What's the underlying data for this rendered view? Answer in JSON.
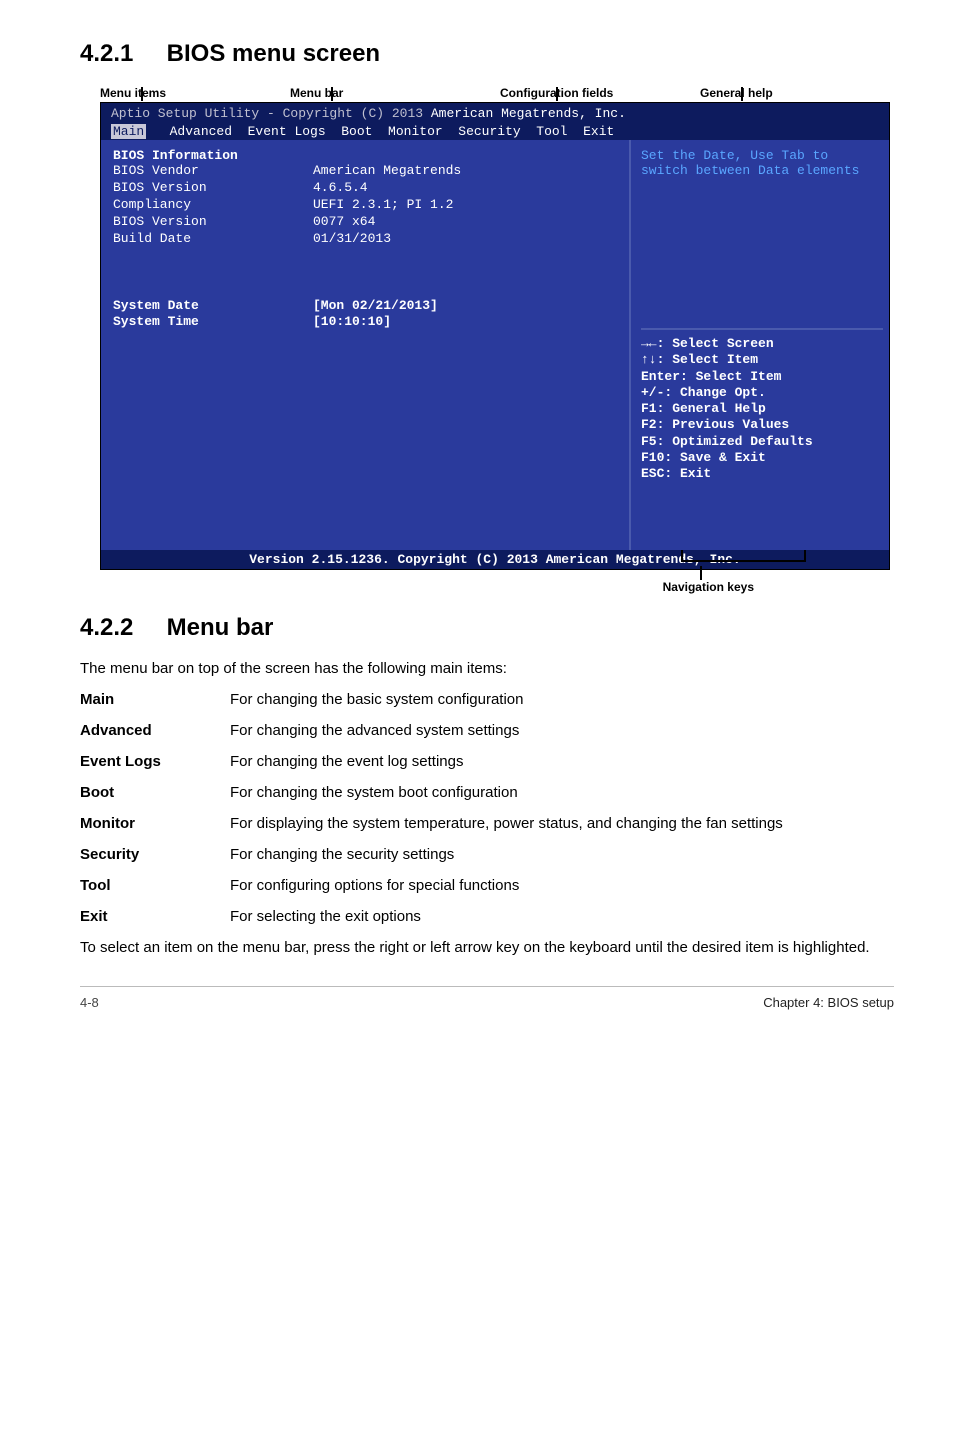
{
  "section1": {
    "num": "4.2.1",
    "title": "BIOS menu screen"
  },
  "labels": {
    "menu_items": "Menu items",
    "menu_bar": "Menu bar",
    "config_fields": "Configuration fields",
    "general_help": "General help",
    "nav_keys": "Navigation keys"
  },
  "bios": {
    "header_line1a": "Aptio Setup Utility - Copyright (C) 2013 ",
    "header_line1b": "American Megatrends, Inc.",
    "tabs": {
      "main": "Main",
      "rest": "   Advanced  Event Logs  Boot  Monitor  Security  Tool  Exit"
    },
    "info_header": "BIOS Information",
    "rows": [
      {
        "label": "BIOS Vendor",
        "value": "American Megatrends"
      },
      {
        "label": "BIOS Version",
        "value": "4.6.5.4"
      },
      {
        "label": "Compliancy",
        "value": "UEFI 2.3.1; PI 1.2"
      },
      {
        "label": "BIOS Version",
        "value": "0077 x64"
      },
      {
        "label": "Build Date",
        "value": "01/31/2013"
      }
    ],
    "sysdate_lbl": "System Date",
    "sysdate_val": "[Mon 02/21/2013]",
    "systime_lbl": "System Time",
    "systime_val": "[10:10:10]",
    "help1a": "Set the Date, Use Tab to",
    "help1b": "switch between Data elements",
    "help2": [
      "→←: Select Screen",
      "↑↓:  Select Item",
      "Enter: Select Item",
      "+/-: Change Opt.",
      "F1: General Help",
      "F2: Previous Values",
      "F5: Optimized Defaults",
      "F10: Save & Exit",
      "ESC: Exit"
    ],
    "footer": "Version 2.15.1236. Copyright (C) 2013 American Megatrends, Inc."
  },
  "section2": {
    "num": "4.2.2",
    "title": "Menu bar"
  },
  "intro": "The menu bar on top of the screen has the following main items:",
  "defs": [
    {
      "term": "Main",
      "desc": "For changing the basic system configuration"
    },
    {
      "term": "Advanced",
      "desc": "For changing the advanced system settings"
    },
    {
      "term": "Event Logs",
      "desc": "For changing the event log settings"
    },
    {
      "term": "Boot",
      "desc": "For changing the system boot configuration"
    },
    {
      "term": "Monitor",
      "desc": "For displaying the system temperature, power status, and changing the fan settings"
    },
    {
      "term": "Security",
      "desc": "For changing the security settings"
    },
    {
      "term": "Tool",
      "desc": "For configuring options for special functions"
    },
    {
      "term": "Exit",
      "desc": "For selecting the exit options"
    }
  ],
  "post": "To select an item on the menu bar, press the right or left arrow key on the keyboard until the desired item is highlighted.",
  "footer": {
    "page": "4-8",
    "chapter": "Chapter 4: BIOS setup"
  }
}
